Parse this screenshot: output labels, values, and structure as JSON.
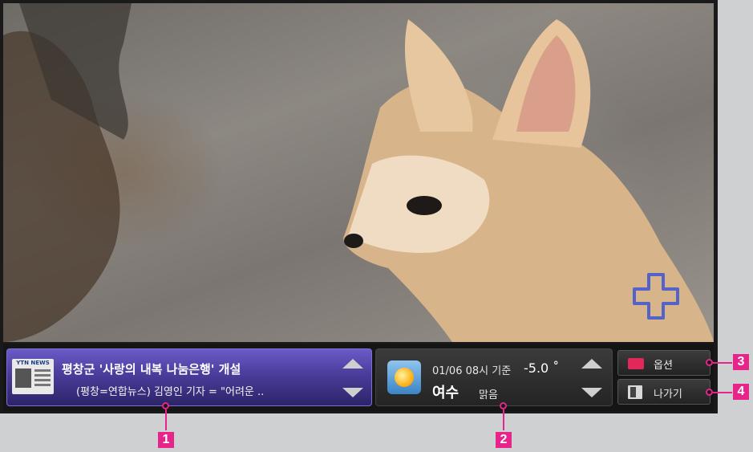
{
  "news": {
    "logo": "YTN NEWS",
    "headline": "평창군 '사랑의 내복 나눔은행' 개설",
    "subline": "(평창=연합뉴스) 김영인 기자 = \"어려운 ..",
    "icon": "newspaper-icon"
  },
  "weather": {
    "timestamp": "01/06 08시 기준",
    "temperature": "-5.0 ˚",
    "city": "여수",
    "condition": "맑음",
    "icon": "sun-icon"
  },
  "buttons": {
    "options": "옵션",
    "exit": "나가기"
  },
  "callouts": {
    "c1": "1",
    "c2": "2",
    "c3": "3",
    "c4": "4"
  },
  "colors": {
    "callout": "#e6248a",
    "news_panel": "#4a3c9b",
    "option_key": "#e0285a"
  }
}
